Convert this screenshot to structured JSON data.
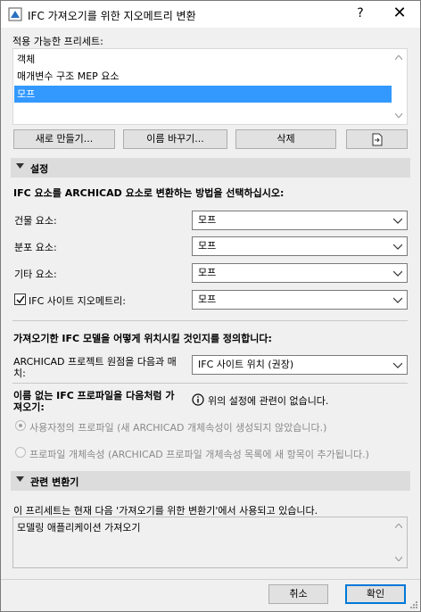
{
  "window": {
    "title": "IFC 가져오기를 위한 지오메트리 변환",
    "help": "?",
    "close": "✕"
  },
  "presets": {
    "label": "적용 가능한 프리세트:",
    "items": [
      "객체",
      "매개변수 구조 MEP 요소",
      "모프"
    ],
    "selected_index": 2
  },
  "preset_buttons": {
    "new": "새로 만들기...",
    "rename": "이름 바꾸기...",
    "delete": "삭제"
  },
  "settings": {
    "header": "설정",
    "instruction": "IFC 요소를 ARCHICAD 요소로 변환하는 방법을 선택하십시오:",
    "rows": [
      {
        "label": "건물 요소:",
        "value": "모프"
      },
      {
        "label": "분포 요소:",
        "value": "모프"
      },
      {
        "label": "기타 요소:",
        "value": "모프"
      },
      {
        "label": "IFC 사이트 지오메트리:",
        "value": "모프",
        "checked": true
      }
    ],
    "placement_heading": "가져오기한 IFC 모델을 어떻게 위치시킬 것인지를 정의합니다:",
    "origin_label_line1": "ARCHICAD 프로젝트 원점을 다음과 매",
    "origin_label_line2": "치:",
    "origin_value": "IFC 사이트 위치 (권장)",
    "unnamed_label_line1": "이름 없는 IFC 프로파일을 다음처럼 가",
    "unnamed_label_line2": "져오기:",
    "info_text": "위의 설정에 관련이 없습니다.",
    "radio_custom": "사용자정의 프로파일 (새 ARCHICAD 개체속성이 생성되지 않았습니다.)",
    "radio_attr": "프로파일 개체속성 (ARCHICAD 프로파일 개체속성 목록에 새 항목이 추가됩니다.)"
  },
  "translators": {
    "header": "관련 변환기",
    "description": "이 프리세트는 현재 다음 '가져오기를 위한 변환기'에서 사용되고 있습니다.",
    "items": [
      "모델링 애플리케이션 가져오기"
    ]
  },
  "footer": {
    "cancel": "취소",
    "ok": "확인"
  }
}
